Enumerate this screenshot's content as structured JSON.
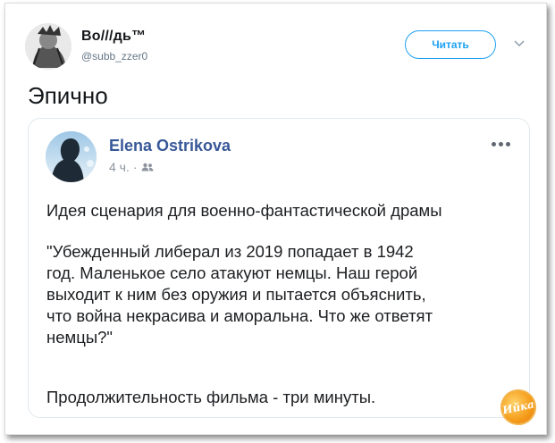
{
  "tweet": {
    "author_name": "Во///дь™",
    "author_handle": "@subb_zzer0",
    "follow_label": "Читать",
    "text": "Эпично"
  },
  "quoted_post": {
    "author": "Elena Ostrikova",
    "time": "4 ч.",
    "audience_icon": "friends-icon",
    "paragraphs": [
      "Идея сценария для военно-фантастической драмы",
      "\"Убежденный либерал из 2019 попадает в 1942\nгод. Маленькое село атакуют немцы. Наш герой\nвыходит к ним без оружия и пытается объяснить,\nчто война некрасива и аморальна. Что же ответят\nнемцы?\"",
      "Продолжительность фильма - три минуты."
    ]
  },
  "watermark": {
    "text": "Ийка"
  },
  "colors": {
    "twitter_blue": "#1da1f2",
    "facebook_name": "#385898",
    "badge_orange": "#f59c1a"
  }
}
